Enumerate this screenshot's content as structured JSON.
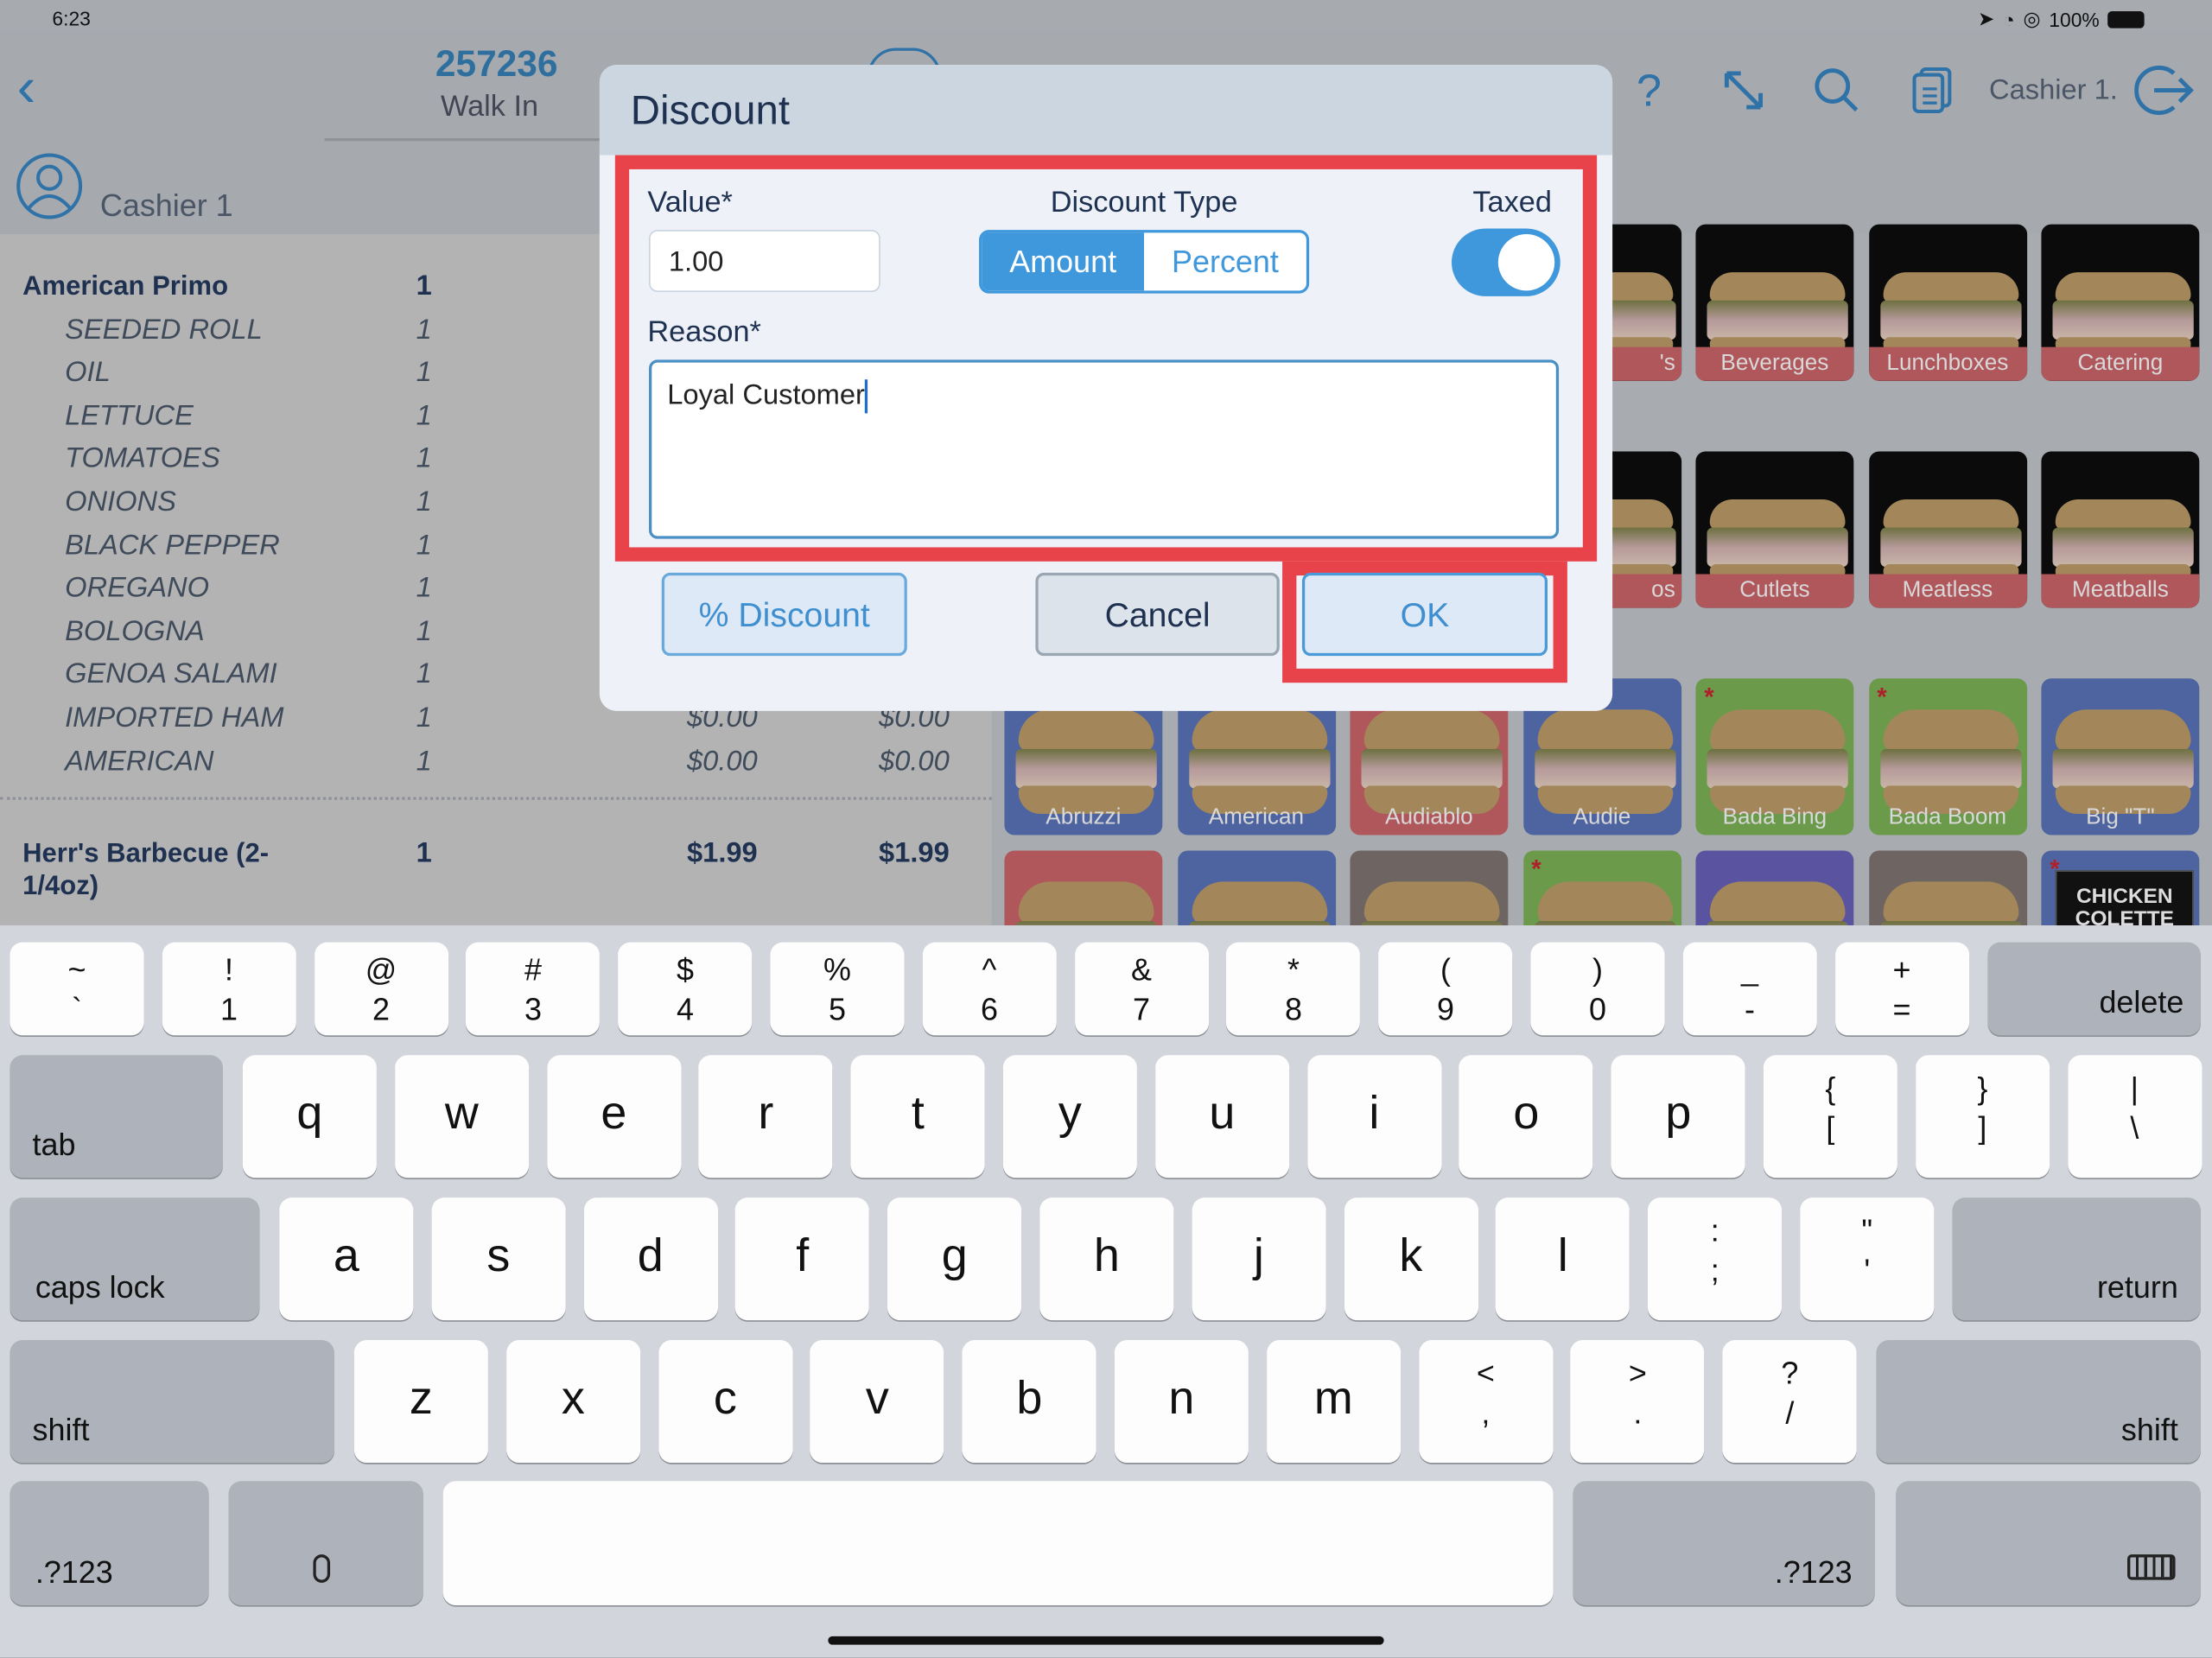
{
  "status_bar": {
    "time": "6:23",
    "battery": "100%"
  },
  "header": {
    "order_number": "257236",
    "order_type": "Walk In",
    "cashier_right": "Cashier 1.",
    "cashier": "Cashier 1"
  },
  "order_items": [
    {
      "name": "American Primo",
      "qty": "1",
      "main": true
    },
    {
      "name": "SEEDED ROLL",
      "qty": "1"
    },
    {
      "name": "OIL",
      "qty": "1"
    },
    {
      "name": "LETTUCE",
      "qty": "1"
    },
    {
      "name": "TOMATOES",
      "qty": "1"
    },
    {
      "name": "ONIONS",
      "qty": "1"
    },
    {
      "name": "BLACK PEPPER",
      "qty": "1"
    },
    {
      "name": "OREGANO",
      "qty": "1"
    },
    {
      "name": "BOLOGNA",
      "qty": "1"
    },
    {
      "name": "GENOA SALAMI",
      "qty": "1"
    },
    {
      "name": "IMPORTED HAM",
      "qty": "1",
      "price": "$0.00",
      "total": "$0.00"
    },
    {
      "name": "AMERICAN",
      "qty": "1",
      "price": "$0.00",
      "total": "$0.00"
    }
  ],
  "order_item_last": {
    "name": "Herr's Barbecue (2-1/4oz)",
    "qty": "1",
    "price": "$1.99",
    "total": "$1.99"
  },
  "categories": [
    {
      "label": "'s",
      "row": 0,
      "col": 3,
      "color": "#0b0b0b",
      "strip": "#b0575c"
    },
    {
      "label": "Beverages",
      "row": 0,
      "col": 4,
      "color": "#0b0b0b",
      "strip": "#b0575c"
    },
    {
      "label": "Lunchboxes",
      "row": 0,
      "col": 5,
      "color": "#0b0b0b",
      "strip": "#b0575c"
    },
    {
      "label": "Catering",
      "row": 0,
      "col": 6,
      "color": "#0b0b0b",
      "strip": "#b0575c"
    },
    {
      "label": "os",
      "row": 1,
      "col": 3,
      "color": "#0b0b0b",
      "strip": "#b0575c"
    },
    {
      "label": "Cutlets",
      "row": 1,
      "col": 4,
      "color": "#0b0b0b",
      "strip": "#b0575c"
    },
    {
      "label": "Meatless",
      "row": 1,
      "col": 5,
      "color": "#0b0b0b",
      "strip": "#b0575c"
    },
    {
      "label": "Meatballs",
      "row": 1,
      "col": 6,
      "color": "#0b0b0b",
      "strip": "#b0575c"
    },
    {
      "label": "Abruzzi",
      "row": 2,
      "col": 0,
      "color": "#4e64a0"
    },
    {
      "label": "American",
      "row": 2,
      "col": 1,
      "color": "#4e64a0"
    },
    {
      "label": "Audiablo",
      "row": 2,
      "col": 2,
      "color": "#b0575c"
    },
    {
      "label": "Audie",
      "row": 2,
      "col": 3,
      "color": "#4e64a0"
    },
    {
      "label": "Bada Bing",
      "row": 2,
      "col": 4,
      "color": "#6a9a4a",
      "star": true
    },
    {
      "label": "Bada Boom",
      "row": 2,
      "col": 5,
      "color": "#6a9a4a",
      "star": true
    },
    {
      "label": "Big \"T\"",
      "row": 2,
      "col": 6,
      "color": "#4e64a0"
    },
    {
      "label": "",
      "row": 3,
      "col": 0,
      "color": "#b0575c"
    },
    {
      "label": "",
      "row": 3,
      "col": 1,
      "color": "#4e64a0"
    },
    {
      "label": "",
      "row": 3,
      "col": 2,
      "color": "#6e6462"
    },
    {
      "label": "",
      "row": 3,
      "col": 3,
      "color": "#6a9a4a",
      "star": true
    },
    {
      "label": "",
      "row": 3,
      "col": 4,
      "color": "#5a54a0"
    },
    {
      "label": "",
      "row": 3,
      "col": 5,
      "color": "#6e6462"
    },
    {
      "label": "CHICKEN COLETTE",
      "row": 3,
      "col": 6,
      "color": "#4e64a0",
      "star": true,
      "dark": true
    }
  ],
  "dialog": {
    "title": "Discount",
    "value_label": "Value*",
    "value": "1.00",
    "discount_type_label": "Discount Type",
    "discount_type_options": [
      "Amount",
      "Percent"
    ],
    "discount_type_selected": "Amount",
    "taxed_label": "Taxed",
    "taxed": true,
    "reason_label": "Reason*",
    "reason": "Loyal Customer",
    "percent_discount_button": "% Discount",
    "cancel_button": "Cancel",
    "ok_button": "OK",
    "highlight_color": "#e8424a",
    "accent_color": "#3f97dc"
  },
  "keyboard": {
    "row1": [
      [
        "~",
        "`"
      ],
      [
        "!",
        "1"
      ],
      [
        "@",
        "2"
      ],
      [
        "#",
        "3"
      ],
      [
        "$",
        "4"
      ],
      [
        "%",
        "5"
      ],
      [
        "^",
        "6"
      ],
      [
        "&",
        "7"
      ],
      [
        "*",
        "8"
      ],
      [
        "(",
        "9"
      ],
      [
        ")",
        "0"
      ],
      [
        "_",
        "-"
      ],
      [
        "+",
        "="
      ]
    ],
    "row2": [
      [
        "",
        "q"
      ],
      [
        "",
        "w"
      ],
      [
        "",
        "e"
      ],
      [
        "",
        "r"
      ],
      [
        "",
        "t"
      ],
      [
        "",
        "y"
      ],
      [
        "",
        "u"
      ],
      [
        "",
        "i"
      ],
      [
        "",
        "o"
      ],
      [
        "",
        "p"
      ],
      [
        "{",
        "["
      ],
      [
        "}",
        "]"
      ],
      [
        "|",
        "\\"
      ]
    ],
    "row3": [
      [
        "",
        "a"
      ],
      [
        "",
        "s"
      ],
      [
        "",
        "d"
      ],
      [
        "",
        "f"
      ],
      [
        "",
        "g"
      ],
      [
        "",
        "h"
      ],
      [
        "",
        "j"
      ],
      [
        "",
        "k"
      ],
      [
        "",
        "l"
      ],
      [
        ":",
        ";"
      ],
      [
        "\"",
        "'"
      ]
    ],
    "row4": [
      [
        "",
        "z"
      ],
      [
        "",
        "x"
      ],
      [
        "",
        "c"
      ],
      [
        "",
        "v"
      ],
      [
        "",
        "b"
      ],
      [
        "",
        "n"
      ],
      [
        "",
        "m"
      ],
      [
        "<",
        ","
      ],
      [
        ">",
        "."
      ],
      [
        "?",
        "/"
      ]
    ],
    "delete": "delete",
    "tab": "tab",
    "caps_lock": "caps lock",
    "return": "return",
    "shift": "shift",
    "numbers": ".?123"
  }
}
